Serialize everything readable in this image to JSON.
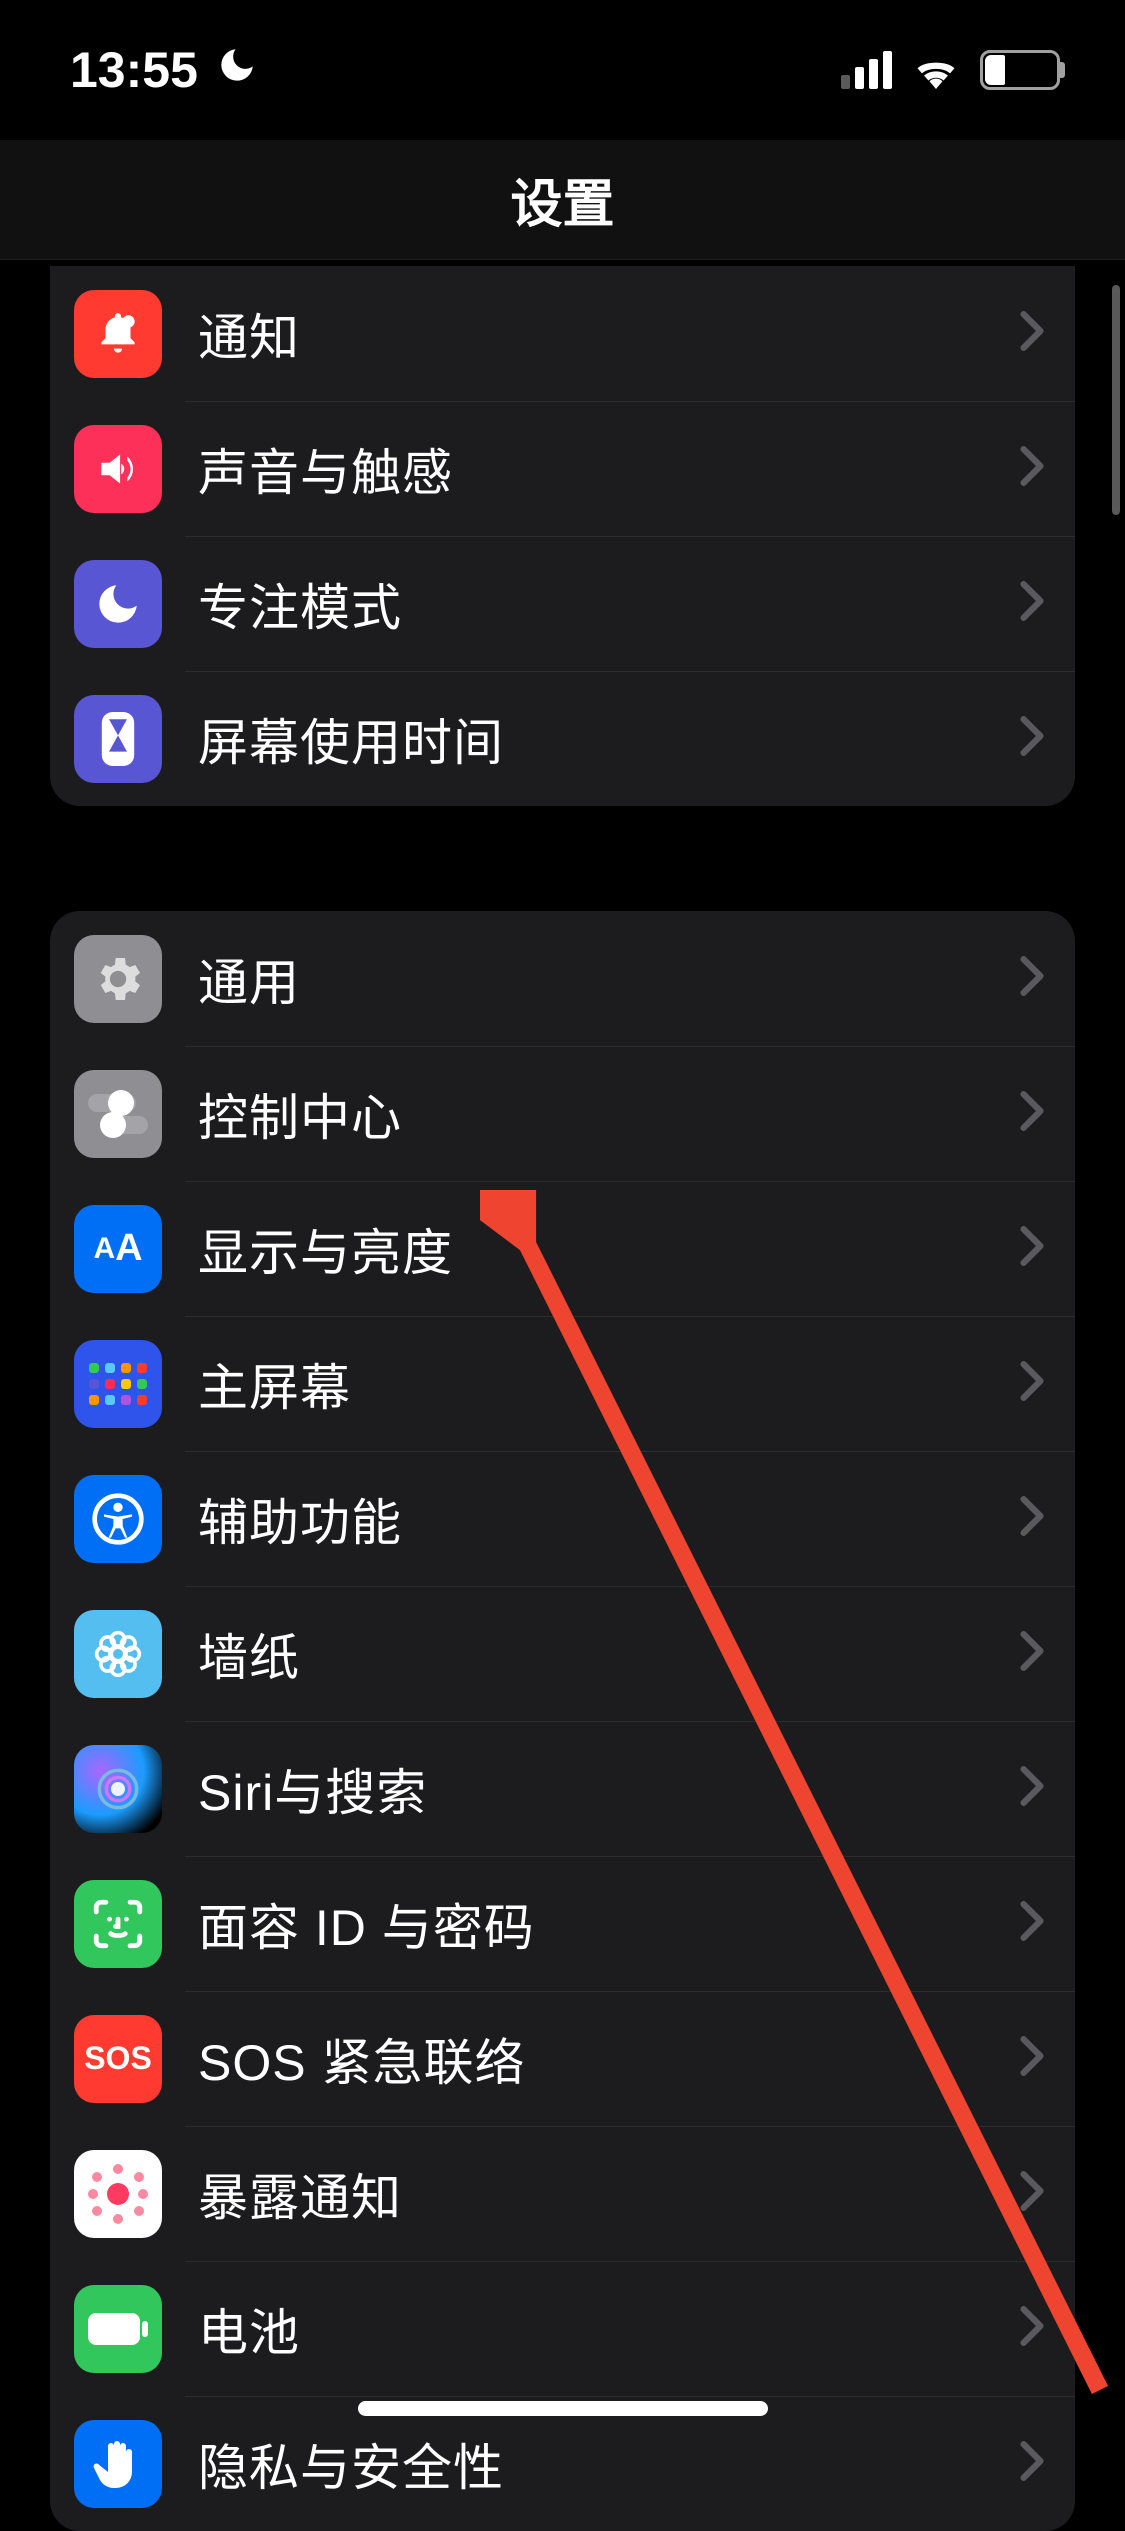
{
  "status": {
    "time": "13:55",
    "battery_percent": "27"
  },
  "nav": {
    "title": "设置"
  },
  "groups": [
    {
      "id": "group1",
      "items": [
        {
          "label": "通知",
          "icon": "bell-icon",
          "bg": "ic-red"
        },
        {
          "label": "声音与触感",
          "icon": "speaker-icon",
          "bg": "ic-pink"
        },
        {
          "label": "专注模式",
          "icon": "moon-icon",
          "bg": "ic-indigo"
        },
        {
          "label": "屏幕使用时间",
          "icon": "hourglass-icon",
          "bg": "ic-indigo"
        }
      ]
    },
    {
      "id": "group2",
      "items": [
        {
          "label": "通用",
          "icon": "gear-icon",
          "bg": "ic-grey"
        },
        {
          "label": "控制中心",
          "icon": "switches-icon",
          "bg": "ic-grey"
        },
        {
          "label": "显示与亮度",
          "icon": "aa-icon",
          "bg": "ic-blue"
        },
        {
          "label": "主屏幕",
          "icon": "apps-grid-icon",
          "bg": "ic-grid"
        },
        {
          "label": "辅助功能",
          "icon": "accessibility-icon",
          "bg": "ic-blue"
        },
        {
          "label": "墙纸",
          "icon": "flower-icon",
          "bg": "ic-cyan"
        },
        {
          "label": "Siri与搜索",
          "icon": "siri-icon",
          "bg": "ic-siri"
        },
        {
          "label": "面容 ID 与密码",
          "icon": "faceid-icon",
          "bg": "ic-green"
        },
        {
          "label": "SOS 紧急联络",
          "icon": "sos-icon",
          "bg": "ic-red"
        },
        {
          "label": "暴露通知",
          "icon": "exposure-icon",
          "bg": "ic-exposure"
        },
        {
          "label": "电池",
          "icon": "battery-icon",
          "bg": "ic-green"
        },
        {
          "label": "隐私与安全性",
          "icon": "hand-icon",
          "bg": "ic-blue"
        }
      ]
    }
  ],
  "icon_text": {
    "aa": "AA",
    "sos": "SOS"
  }
}
